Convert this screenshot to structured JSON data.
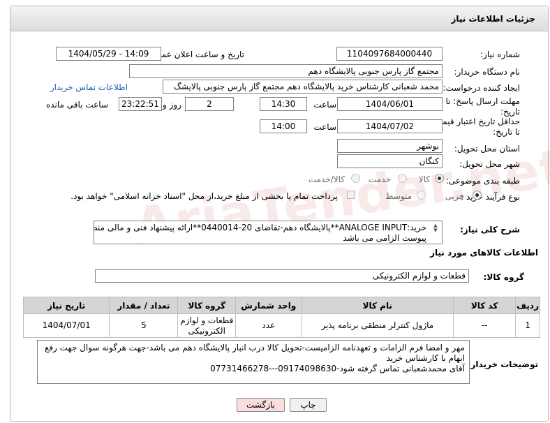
{
  "panel": {
    "title": "جزئیات اطلاعات نیاز"
  },
  "fields": {
    "need_number_label": "شماره نیاز:",
    "need_number_value": "1104097684000440",
    "announce_label": "تاریخ و ساعت اعلان عمومی:",
    "announce_value": "1404/05/29 - 14:09",
    "buyer_org_label": "نام دستگاه خریدار:",
    "buyer_org_value": "مجتمع گاز پارس جنوبی  پالایشگاه دهم",
    "requester_label": "ایجاد کننده درخواست:",
    "requester_value": "محمد شعبانی کارشناس خرید پالایشگاه دهم  مجتمع گاز پارس جنوبی  پالایشگ",
    "buyer_contact_link": "اطلاعات تماس خریدار",
    "deadline_label_1": "مهلت ارسال پاسخ: تا",
    "deadline_label_2": "تاریخ:",
    "deadline_date": "1404/06/01",
    "time_word": "ساعت",
    "deadline_time": "14:30",
    "days_value": "2",
    "days_word": "روز و",
    "remaining_time": "23:22:51",
    "remaining_word": "ساعت باقی مانده",
    "min_validity_label_1": "حداقل تاریخ اعتبار قیمت:",
    "min_validity_label_2": "تا تاریخ:",
    "validity_date": "1404/07/02",
    "validity_time": "14:00",
    "province_label": "استان محل تحویل:",
    "province_value": "بوشهر",
    "city_label": "شهر محل تحویل:",
    "city_value": "کنگان",
    "category_label": "طبقه بندی موضوعی:",
    "category_options": [
      "کالا",
      "خدمت",
      "کالا/خدمت"
    ],
    "category_selected": "کالا",
    "process_label": "نوع فرآیند خرید :",
    "process_options": [
      "جزیی",
      "متوسط"
    ],
    "process_selected": "جزیی",
    "payment_note": "پرداخت تمام یا بخشی از مبلغ خرید،از محل \"اسناد خزانه اسلامی\" خواهد بود."
  },
  "description": {
    "label": "شرح کلی نیاز:",
    "line1": "خرید:ANALOGE INPUT**پالایشگاه دهم-تقاضای 20-0440014**ارائه پیشنهاد فنی و مالی منطبق با فایل",
    "line2": "پیوست الزامی می باشد"
  },
  "goods_section": {
    "title": "اطلاعات کالاهای مورد نیاز",
    "group_label": "گروه کالا:",
    "group_value": "قطعات و لوازم الکترونیکی",
    "columns": [
      "ردیف",
      "کد کالا",
      "نام کالا",
      "واحد شمارش",
      "گروه کالا",
      "تعداد / مقدار",
      "تاریخ نیاز"
    ],
    "rows": [
      {
        "row": "1",
        "code": "--",
        "name": "ماژول کنترلر منطقی برنامه پذیر",
        "unit": "عدد",
        "group_line1": "قطعات و لوازم",
        "group_line2": "الکترونیکی",
        "qty": "5",
        "date": "1404/07/01"
      }
    ]
  },
  "buyer_notes": {
    "label": "توضیحات خریدار:",
    "line1": "مهر و امضا فرم الزامات و تعهدنامه الزامیست-تحویل کالا درب انبار پالایشگاه دهم می باشد-جهت هرگونه سوال جهت رفع",
    "line2": "ابهام با کارشناس خرید",
    "line3": "آقای محمدشعبانی تماس گرفته شود-09174098630---07731466278"
  },
  "buttons": {
    "print": "چاپ",
    "back": "بازگشت"
  },
  "watermark": "AriaTender.net",
  "colors": {
    "link": "#1560bd",
    "back_button_bg": "#f9dede",
    "print_button_bg": "#f1f1f1",
    "header_bg": "#dcdcdc"
  }
}
